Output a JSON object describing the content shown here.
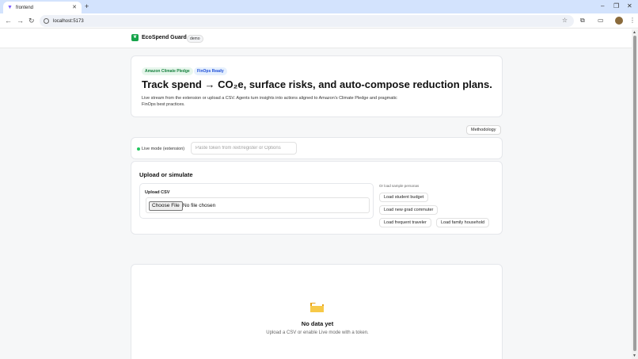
{
  "browser": {
    "tab_title": "frontend",
    "url": "localhost:5173"
  },
  "app": {
    "brand": "EcoSpend Guard",
    "env_badge": "demo",
    "accent": "#16a34a"
  },
  "hero": {
    "badges": [
      "Amazon Climate Pledge",
      "FinOps Ready"
    ],
    "title": "Track spend → CO₂e, surface risks, and auto-compose reduction plans.",
    "description": "Live stream from the extension or upload a CSV. Agents turn insights into actions aligned to Amazon's Climate Pledge and pragmatic FinOps best practices."
  },
  "methodology_label": "Methodology",
  "live": {
    "label": "Live mode (extension)",
    "token_placeholder": "Paste token from /ext/register or Options",
    "token_value": ""
  },
  "upload": {
    "title": "Upload or simulate",
    "csv_label": "Upload CSV",
    "choose_file_label": "Choose File",
    "no_file_label": "No file chosen",
    "personas_title": "Or load sample personas",
    "personas": [
      "Load student budget",
      "Load new grad commuter",
      "Load frequent traveler",
      "Load family household"
    ]
  },
  "empty_state": {
    "title": "No data yet",
    "description": "Upload a CSV or enable Live mode with a token."
  }
}
